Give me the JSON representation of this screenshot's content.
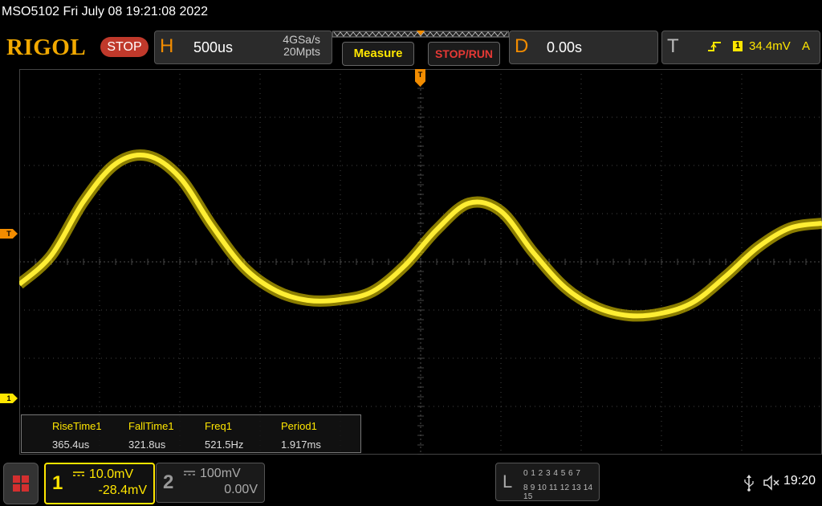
{
  "titlebar": {
    "text": "MSO5102  Fri July 08 19:21:08 2022"
  },
  "header": {
    "brand": "RIGOL",
    "run_state": "STOP",
    "horizontal": {
      "letter": "H",
      "timebase": "500us",
      "sample_rate": "4GSa/s",
      "memory_depth": "20Mpts"
    },
    "measure_label": "Measure",
    "stop_run_label": "STOP/RUN",
    "delay": {
      "letter": "D",
      "value": "0.00s"
    },
    "trigger": {
      "letter": "T",
      "source": "1",
      "level": "34.4mV",
      "mode": "A",
      "edge_icon": "rising-edge-icon"
    }
  },
  "markers": {
    "trigger_left": "T",
    "channel1_left": "1",
    "trigger_top": "T"
  },
  "measurements": [
    {
      "label": "RiseTime1",
      "value": "365.4us"
    },
    {
      "label": "FallTime1",
      "value": "321.8us"
    },
    {
      "label": "Freq1",
      "value": "521.5Hz"
    },
    {
      "label": "Period1",
      "value": "1.917ms"
    }
  ],
  "channels": [
    {
      "number": "1",
      "scale": "10.0mV",
      "offset": "-28.4mV",
      "color": "#ffe600",
      "active": true
    },
    {
      "number": "2",
      "scale": "100mV",
      "offset": "0.00V",
      "color": "#999999",
      "active": false
    }
  ],
  "logic": {
    "letter": "L",
    "row1": "0 1 2 3  4 5 6 7",
    "row2": "8 9 10 11 12 13 14 15"
  },
  "status": {
    "time": "19:20",
    "usb_icon": "usb-icon",
    "sound_icon": "muted-speaker-icon"
  },
  "colors": {
    "trace": "#ffe600",
    "accent": "#f28c00",
    "grid": "#555555"
  }
}
